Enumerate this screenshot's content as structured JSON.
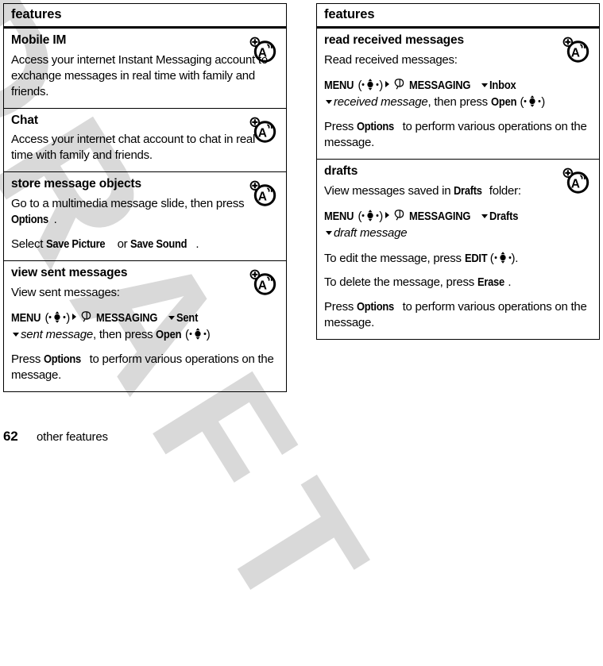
{
  "document": {
    "footer": {
      "page_number": "62",
      "chapter": "other features"
    },
    "watermark": {
      "text": "DRAFT",
      "color": "#d9d9d9"
    },
    "colors": {
      "text": "#000000",
      "rule": "#000000",
      "background": "#ffffff",
      "watermark": "#d9d9d9"
    },
    "icon_names": {
      "feature_icon": "network-feature-icon",
      "joystick": "joystick-center-select-icon",
      "messaging": "messaging-speech-bubble-icon",
      "arrow_right": "arrow-right-icon",
      "arrow_down": "arrow-down-icon"
    }
  },
  "left_table": {
    "header": "features",
    "rows": [
      {
        "title": "Mobile IM",
        "icon": "network-feature-icon",
        "body": [
          {
            "type": "paragraph",
            "text": "Access your internet Instant Messaging account to exchange messages in real time with family and friends."
          }
        ]
      },
      {
        "title": "Chat",
        "icon": "network-feature-icon",
        "body": [
          {
            "type": "paragraph",
            "text": "Access your internet chat account to chat in real time with family and friends."
          }
        ]
      },
      {
        "title": "store message objects",
        "icon": "network-feature-icon",
        "body": [
          {
            "type": "rich",
            "segments": [
              {
                "style": "plain",
                "text": "Go to a multimedia message slide, then press "
              },
              {
                "style": "key",
                "text": "Options"
              },
              {
                "style": "plain",
                "text": "."
              }
            ]
          },
          {
            "type": "rich",
            "segments": [
              {
                "style": "plain",
                "text": "Select "
              },
              {
                "style": "key",
                "text": "Save Picture"
              },
              {
                "style": "plain",
                "text": " or "
              },
              {
                "style": "key",
                "text": "Save Sound"
              },
              {
                "style": "plain",
                "text": "."
              }
            ]
          }
        ]
      },
      {
        "title": "view sent messages",
        "icon": "network-feature-icon",
        "body": [
          {
            "type": "paragraph",
            "text": "View sent messages:"
          },
          {
            "type": "navpath",
            "segments": [
              {
                "style": "key",
                "text": "MENU"
              },
              {
                "style": "plain",
                "text": "("
              },
              {
                "style": "joystick"
              },
              {
                "style": "plain",
                "text": ")"
              },
              {
                "style": "arrow-right"
              },
              {
                "style": "msgicon"
              },
              {
                "style": "key",
                "text": "MESSAGING"
              },
              {
                "style": "arrow-down"
              },
              {
                "style": "key",
                "text": "Sent"
              },
              {
                "style": "break"
              },
              {
                "style": "arrow-down"
              },
              {
                "style": "var",
                "text": "sent message"
              },
              {
                "style": "plain",
                "text": ", then press "
              },
              {
                "style": "key",
                "text": "Open"
              },
              {
                "style": "plain",
                "text": "("
              },
              {
                "style": "joystick"
              },
              {
                "style": "plain",
                "text": ")"
              }
            ]
          },
          {
            "type": "rich",
            "segments": [
              {
                "style": "plain",
                "text": "Press "
              },
              {
                "style": "key",
                "text": "Options"
              },
              {
                "style": "plain",
                "text": " to perform various operations on the message."
              }
            ]
          }
        ]
      }
    ]
  },
  "right_table": {
    "header": "features",
    "rows": [
      {
        "title": "read received messages",
        "icon": "network-feature-icon",
        "body": [
          {
            "type": "paragraph",
            "text": "Read received messages:"
          },
          {
            "type": "navpath",
            "segments": [
              {
                "style": "key",
                "text": "MENU"
              },
              {
                "style": "plain",
                "text": "("
              },
              {
                "style": "joystick"
              },
              {
                "style": "plain",
                "text": ")"
              },
              {
                "style": "arrow-right"
              },
              {
                "style": "msgicon"
              },
              {
                "style": "key",
                "text": "MESSAGING"
              },
              {
                "style": "arrow-down"
              },
              {
                "style": "key",
                "text": "Inbox"
              },
              {
                "style": "break"
              },
              {
                "style": "arrow-down"
              },
              {
                "style": "var",
                "text": "received message"
              },
              {
                "style": "plain",
                "text": ", then press "
              },
              {
                "style": "key",
                "text": "Open"
              },
              {
                "style": "plain",
                "text": "("
              },
              {
                "style": "joystick"
              },
              {
                "style": "plain",
                "text": ")"
              }
            ]
          },
          {
            "type": "rich",
            "segments": [
              {
                "style": "plain",
                "text": "Press "
              },
              {
                "style": "key",
                "text": "Options"
              },
              {
                "style": "plain",
                "text": " to perform various operations on the message."
              }
            ]
          }
        ]
      },
      {
        "title": "drafts",
        "icon": "network-feature-icon",
        "body": [
          {
            "type": "rich",
            "segments": [
              {
                "style": "plain",
                "text": "View messages saved in "
              },
              {
                "style": "key",
                "text": "Drafts"
              },
              {
                "style": "plain",
                "text": " folder:"
              }
            ]
          },
          {
            "type": "navpath",
            "segments": [
              {
                "style": "key",
                "text": "MENU"
              },
              {
                "style": "plain",
                "text": "("
              },
              {
                "style": "joystick"
              },
              {
                "style": "plain",
                "text": ")"
              },
              {
                "style": "arrow-right"
              },
              {
                "style": "msgicon"
              },
              {
                "style": "key",
                "text": "MESSAGING"
              },
              {
                "style": "arrow-down"
              },
              {
                "style": "key",
                "text": "Drafts"
              },
              {
                "style": "break"
              },
              {
                "style": "arrow-down"
              },
              {
                "style": "var",
                "text": "draft message"
              }
            ]
          },
          {
            "type": "rich",
            "segments": [
              {
                "style": "plain",
                "text": "To edit the message, press "
              },
              {
                "style": "key",
                "text": "EDIT"
              },
              {
                "style": "plain",
                "text": "("
              },
              {
                "style": "joystick"
              },
              {
                "style": "plain",
                "text": ")."
              }
            ]
          },
          {
            "type": "rich",
            "segments": [
              {
                "style": "plain",
                "text": "To delete the message, press "
              },
              {
                "style": "key",
                "text": "Erase"
              },
              {
                "style": "plain",
                "text": "."
              }
            ]
          },
          {
            "type": "rich",
            "segments": [
              {
                "style": "plain",
                "text": "Press "
              },
              {
                "style": "key",
                "text": "Options"
              },
              {
                "style": "plain",
                "text": " to perform various operations on the message."
              }
            ]
          }
        ]
      }
    ]
  }
}
